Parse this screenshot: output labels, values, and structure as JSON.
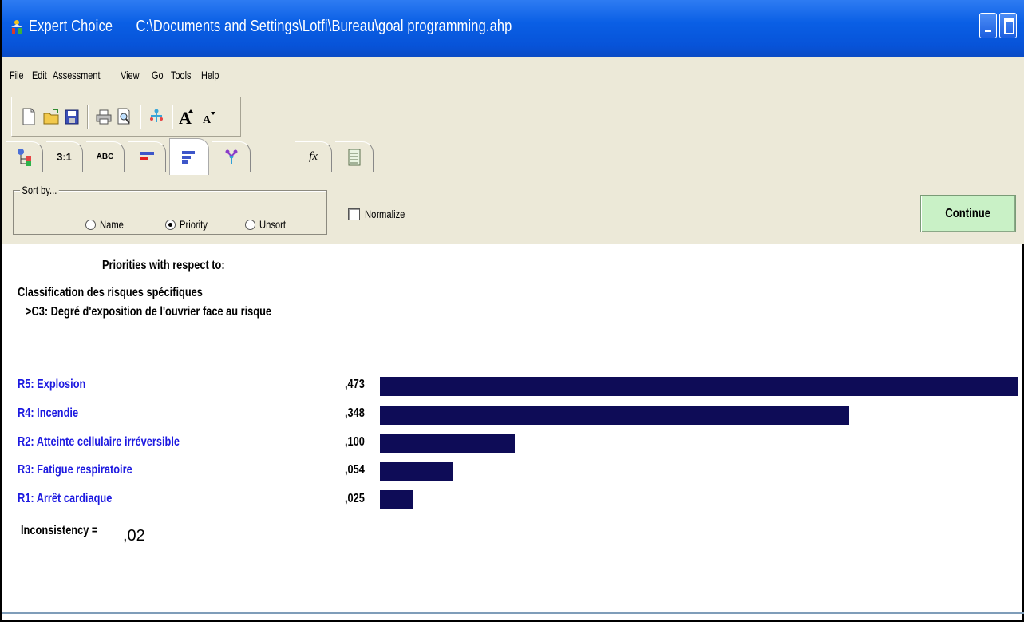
{
  "window": {
    "app_name": "Expert Choice",
    "file_path": "C:\\Documents and Settings\\Lotfi\\Bureau\\goal programming.ahp"
  },
  "menu": [
    "File",
    "Edit",
    "Assessment",
    "View",
    "Go",
    "Tools",
    "Help"
  ],
  "toolbar": {
    "icons": [
      "new-file-icon",
      "open-folder-icon",
      "save-icon",
      "print-icon",
      "print-preview-icon",
      "tree-icon",
      "font-larger-icon",
      "font-smaller-icon"
    ]
  },
  "tabs": [
    {
      "icon": "tree-view-icon",
      "label": ""
    },
    {
      "icon": "",
      "label": "3:1"
    },
    {
      "icon": "",
      "label": "ABC"
    },
    {
      "icon": "graph-bars-icon",
      "label": ""
    },
    {
      "icon": "priority-bars-icon",
      "label": "",
      "active": true
    },
    {
      "icon": "sensitivity-icon",
      "label": ""
    },
    {
      "icon": "formula-icon",
      "label": "fx"
    },
    {
      "icon": "data-grid-icon",
      "label": ""
    }
  ],
  "sort": {
    "legend": "Sort by...",
    "options": [
      "Name",
      "Priority",
      "Unsort"
    ],
    "selected": "Priority"
  },
  "normalize": {
    "label": "Normalize",
    "checked": false
  },
  "continue_label": "Continue",
  "content": {
    "heading": "Priorities with respect to:",
    "goal": "Classification des risques spécifiques",
    "criterion": ">C3: Degré d'exposition de l'ouvrier face au  risque",
    "inconsistency_label": "Inconsistency =",
    "inconsistency_value": ",02"
  },
  "chart_data": {
    "type": "bar",
    "orientation": "horizontal",
    "categories": [
      "R5: Explosion",
      "R4: Incendie",
      "R2: Atteinte cellulaire irréversible",
      "R3: Fatigue respiratoire",
      "R1: Arrêt cardiaque"
    ],
    "value_labels": [
      ",473",
      ",348",
      ",100",
      ",054",
      ",025"
    ],
    "values": [
      0.473,
      0.348,
      0.1,
      0.054,
      0.025
    ],
    "bar_color": "#0e0c57",
    "label_color": "#1d1ae0"
  }
}
